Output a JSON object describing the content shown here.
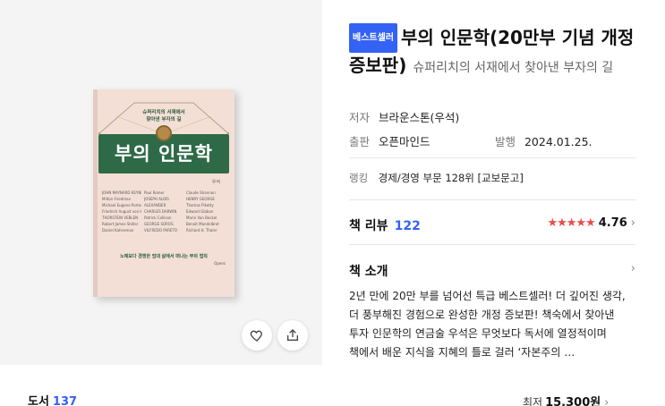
{
  "book": {
    "badge": "베스트셀러",
    "title": "부의 인문학(20만부 기념 개정증보판)",
    "subtitle": "슈퍼리치의 서재에서 찾아낸 부자의 길",
    "author_label": "저자",
    "author": "브라운스톤(우석)",
    "publisher_label": "출판",
    "publisher": "오픈마인드",
    "date_label": "발행",
    "date": "2024.01.25.",
    "rank_label": "랭킹",
    "rank": "경제/경영 부문 128위 [교보문고]"
  },
  "cover": {
    "top_line1": "슈퍼리치의 서재에서",
    "top_line2": "찾아낸 부자의 길",
    "band_title": "부의 인문학",
    "author": "우석",
    "names": [
      "JOHN MAYNARD KEYNES",
      "Paul Romer",
      "Claude Shannon",
      "Milton Friedman",
      "JOSEPH ALOIS",
      "HENRY GEORGE",
      "Michael Eugene Porter",
      "ALEXANDER",
      "Thomas Piketty",
      "Friedrich August von Hayek",
      "CHARLES DARWIN",
      "Edward Gibbon",
      "THORSTEIN VEBLEN",
      "Patrick Collison",
      "Marin Van Bockel",
      "Robert James Shiller",
      "GEORGE SOROS",
      "Benoit Mandelbrot",
      "Daniel Kahneman",
      "VILFREDO PARETO",
      "Richard H. Thaler"
    ],
    "bottom_line": "노예보다 경쟁한 엄대 삶에서 떠나는 부의 법칙",
    "publisher_mark": "Opens"
  },
  "review": {
    "title": "책 리뷰",
    "count": "122",
    "stars": "★★★★★",
    "score": "4.76",
    "chevron": "›"
  },
  "intro": {
    "title": "책 소개",
    "chevron": "›",
    "text": "2년 만에 20만 부를 넘어선 특급 베스트셀러! 더 깊어진 생각, 더 풍부해진 경험으로 완성한 개정 증보판! 책숙에서 찾아낸 투자 인문학의 연금술 우석은 무엇보다 독서에 열정적이며 책에서 배운 지식을 지혜의 틀로 걸러 ‘자본주의 …"
  },
  "footer": {
    "category_label": "도서",
    "category_count": "137",
    "price_prefix": "최저",
    "price": "15,300원",
    "chevron": "›"
  },
  "icons": {
    "like": "heart-icon",
    "share": "share-icon"
  },
  "colors": {
    "accent": "#3462f4",
    "star": "#e94b4b",
    "cover_green": "#2e6a47",
    "cover_bg": "#f3dfd6"
  }
}
